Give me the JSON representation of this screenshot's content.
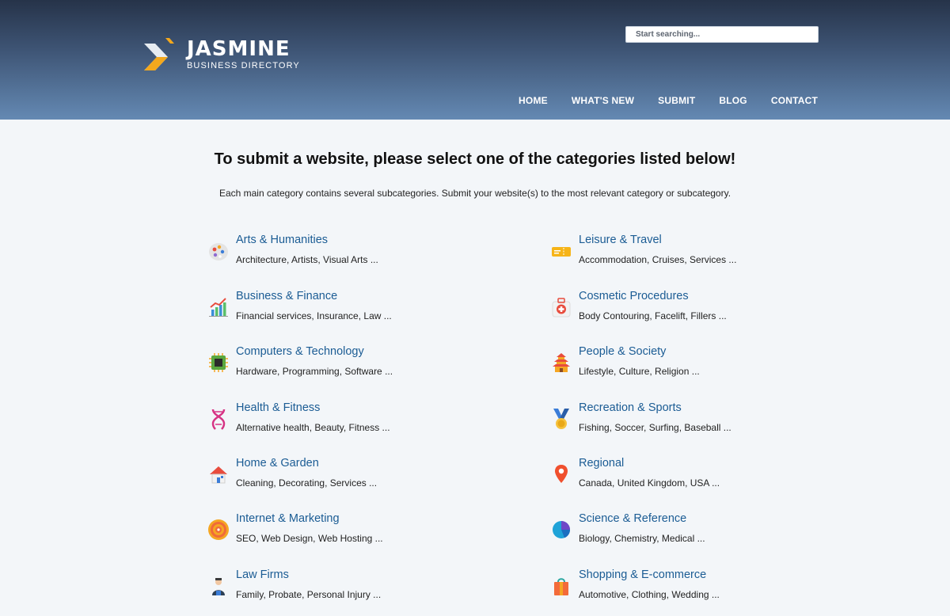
{
  "logo": {
    "name": "JASMINE",
    "tagline": "BUSINESS DIRECTORY"
  },
  "search": {
    "placeholder": "Start searching..."
  },
  "nav": [
    "HOME",
    "WHAT'S NEW",
    "SUBMIT",
    "BLOG",
    "CONTACT"
  ],
  "intro": {
    "heading": "To submit a website, please select one of the categories listed below!",
    "text": "Each main category contains several subcategories. Submit your website(s) to the most relevant category or subcategory."
  },
  "categories": [
    {
      "title": "Arts & Humanities",
      "subs": "Architecture, Artists, Visual Arts ...",
      "icon": "palette-icon"
    },
    {
      "title": "Leisure & Travel",
      "subs": "Accommodation, Cruises, Services ...",
      "icon": "ticket-icon"
    },
    {
      "title": "Business & Finance",
      "subs": "Financial services, Insurance, Law ...",
      "icon": "growth-chart-icon"
    },
    {
      "title": "Cosmetic Procedures",
      "subs": "Body Contouring, Facelift, Fillers ...",
      "icon": "first-aid-kit-icon"
    },
    {
      "title": "Computers & Technology",
      "subs": "Hardware, Programming, Software ...",
      "icon": "cpu-chip-icon"
    },
    {
      "title": "People & Society",
      "subs": "Lifestyle, Culture, Religion ...",
      "icon": "pagoda-icon"
    },
    {
      "title": "Health & Fitness",
      "subs": "Alternative health, Beauty, Fitness ...",
      "icon": "dna-icon"
    },
    {
      "title": "Recreation & Sports",
      "subs": "Fishing, Soccer, Surfing, Baseball ...",
      "icon": "medal-icon"
    },
    {
      "title": "Home & Garden",
      "subs": "Cleaning, Decorating, Services ...",
      "icon": "house-icon"
    },
    {
      "title": "Regional",
      "subs": "Canada, United Kingdom, USA ...",
      "icon": "map-pin-icon"
    },
    {
      "title": "Internet & Marketing",
      "subs": "SEO, Web Design, Web Hosting ...",
      "icon": "target-icon"
    },
    {
      "title": "Science & Reference",
      "subs": "Biology, Chemistry, Medical ...",
      "icon": "pie-chart-icon"
    },
    {
      "title": "Law Firms",
      "subs": "Family, Probate, Personal Injury ...",
      "icon": "lawyer-icon"
    },
    {
      "title": "Shopping & E-commerce",
      "subs": "Automotive, Clothing, Wedding ...",
      "icon": "shopping-bag-icon"
    }
  ]
}
